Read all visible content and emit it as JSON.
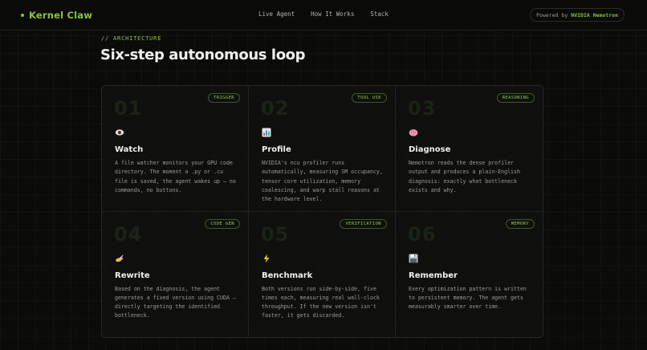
{
  "nav": {
    "brand": "Kernel Claw",
    "links": [
      "Live Agent",
      "How It Works",
      "Stack"
    ],
    "powered_prefix": "Powered by",
    "powered_brand": "NVIDIA Nemotron"
  },
  "section": {
    "eyebrow": "// ARCHITECTURE",
    "title": "Six-step autonomous loop"
  },
  "steps": [
    {
      "number": "01",
      "tag": "TRIGGER",
      "icon": "eye-icon",
      "title": "Watch",
      "desc": "A file watcher monitors your GPU code directory. The moment a .py or .cu file is saved, the agent wakes up — no commands, no buttons."
    },
    {
      "number": "02",
      "tag": "TOOL USE",
      "icon": "bar-chart-icon",
      "title": "Profile",
      "desc": "NVIDIA's ncu profiler runs automatically, measuring SM occupancy, tensor core utilization, memory coalescing, and warp stall reasons at the hardware level."
    },
    {
      "number": "03",
      "tag": "REASONING",
      "icon": "brain-icon",
      "title": "Diagnose",
      "desc": "Nemotron reads the dense profiler output and produces a plain-English diagnosis: exactly what bottleneck exists and why."
    },
    {
      "number": "04",
      "tag": "CODE GEN",
      "icon": "writing-hand-icon",
      "title": "Rewrite",
      "desc": "Based on the diagnosis, the agent generates a fixed version using CUDA — directly targeting the identified bottleneck."
    },
    {
      "number": "05",
      "tag": "VERIFICATION",
      "icon": "lightning-icon",
      "title": "Benchmark",
      "desc": "Both versions run side-by-side, five times each, measuring real wall-clock throughput. If the new version isn't faster, it gets discarded."
    },
    {
      "number": "06",
      "tag": "MEMORY",
      "icon": "floppy-disk-icon",
      "title": "Remember",
      "desc": "Every optimization pattern is written to persistent memory. The agent gets measurably smarter over time."
    }
  ]
}
